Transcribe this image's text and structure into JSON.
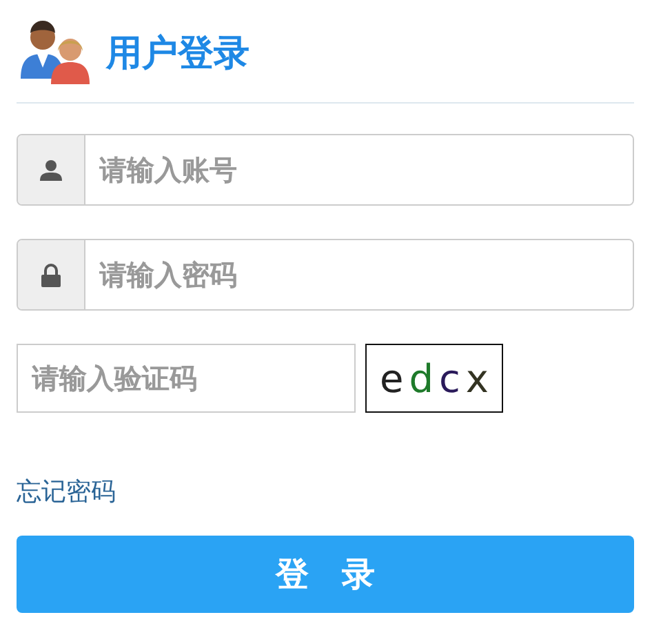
{
  "header": {
    "title": "用户登录"
  },
  "fields": [
    {
      "kind": "user",
      "placeholder": "请输入账号"
    },
    {
      "kind": "lock",
      "placeholder": "请输入密码"
    }
  ],
  "captcha": {
    "placeholder": "请输入验证码",
    "chars": [
      {
        "text": "e",
        "color": "#222222"
      },
      {
        "text": "d",
        "color": "#1e7a2a"
      },
      {
        "text": "c",
        "color": "#2a1a5a"
      },
      {
        "text": "x",
        "color": "#333322"
      }
    ]
  },
  "forgot_link": "忘记密码",
  "submit_button": "登　录"
}
